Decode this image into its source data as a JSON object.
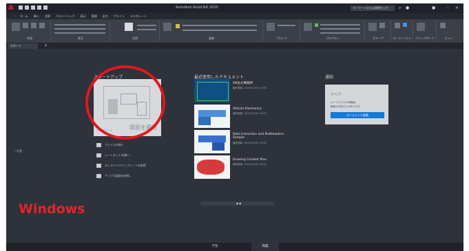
{
  "app": {
    "title": "Autodesk AutoCAD 2020",
    "search_placeholder": "キーワードまたは質問を入力"
  },
  "ribbon_tabs": [
    "ホーム",
    "挿入",
    "注釈",
    "パラメトリック",
    "表示",
    "管理",
    "出力",
    "アドイン",
    "コラボレート"
  ],
  "ribbon_panels": [
    "作成",
    "修正",
    "注釈",
    "画層",
    "ブロック",
    "プロパティ",
    "グループ",
    "ユーティリティ",
    "クリップボード",
    "ビュー"
  ],
  "doc_tab": {
    "label": "スタート"
  },
  "start": {
    "heading": "スタートアップ",
    "tile_label": "図面を開始",
    "templates_label": "テンプレート",
    "items": [
      {
        "label": "ファイルを開く"
      },
      {
        "label": "シートセットを開く..."
      },
      {
        "label": "オンラインでテンプレートを取得"
      },
      {
        "label": "サンプル図面を参照..."
      }
    ],
    "learn_label": "学習"
  },
  "recent": {
    "heading": "最近使用したドキュメント",
    "docs": [
      {
        "name": "PM主力事務所",
        "meta": "最終更新: 2019/12/09 10:43"
      },
      {
        "name": "Vehicle Electronics",
        "meta": "最終更新: 2019/12/09 10:42"
      },
      {
        "name": "Data Extraction and Multileaders Sample",
        "meta": "最終更新: 2019/12/09 10:42"
      },
      {
        "name": "Drawing Content Plan",
        "meta": "最終更新: 2019/12/09 10:41"
      }
    ]
  },
  "notifications": {
    "heading": "通知",
    "line1": "ようこそ",
    "line2": "オートデスクの体験版",
    "line3": "最新のお知らせがあります",
    "button": "オンラインで参照"
  },
  "overlay": {
    "label": "Windows",
    "color": "#e5232a"
  },
  "bottom_tabs": [
    {
      "label": "学習"
    },
    {
      "label": "作成"
    }
  ]
}
